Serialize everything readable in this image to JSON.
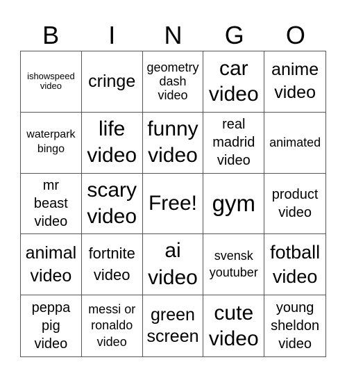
{
  "title_letters": [
    "B",
    "I",
    "N",
    "G",
    "O"
  ],
  "cells": [
    [
      "ishowspeed video",
      "cringe",
      "geometry dash video",
      "car video",
      "anime video"
    ],
    [
      "waterpark bingo",
      "life video",
      "funny video",
      "real madrid video",
      "animated"
    ],
    [
      "mr beast video",
      "scary video",
      "Free!",
      "gym",
      "product video"
    ],
    [
      "animal video",
      "fortnite video",
      "ai video",
      "svensk youtuber",
      "fotball video"
    ],
    [
      "peppa pig video",
      "messi or ronaldo video",
      "green screen",
      "cute video",
      "young sheldon video"
    ]
  ]
}
